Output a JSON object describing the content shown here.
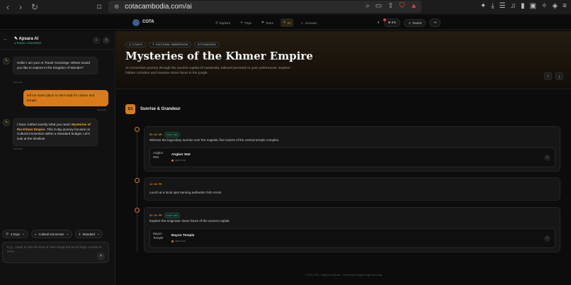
{
  "browser": {
    "url": "cotacambodia.com/ai",
    "brave_badge": "9"
  },
  "app_nav": {
    "brand": "COTA",
    "links": [
      {
        "label": "Explore"
      },
      {
        "label": "Trips"
      },
      {
        "label": "Tours"
      },
      {
        "label": "AI"
      },
      {
        "label": "Account"
      }
    ],
    "language": "EN",
    "role": "Tourist"
  },
  "sidebar": {
    "title": "Apsara AI",
    "subtitle": "● TRAVEL CONCIERGE",
    "messages": [
      {
        "from": "ai",
        "text": "Hello! I am your AI Travel Concierge. Where would you like to explore in the Kingdom of Wonder?",
        "time": "09:41 AM"
      },
      {
        "from": "user",
        "text": "tell me some place in siem reab for culture and temple",
        "time": "09:42 AM"
      },
      {
        "from": "ai",
        "text_before": "I have crafted exactly what you need: ",
        "highlight": "Mysteries of the Khmer Empire",
        "text_after": ". This 3-day journey focuses on Cultural Immersion within a Standard budget. Let's look at the timeline!",
        "time": "09:42 AM"
      }
    ],
    "filters": [
      {
        "label": "3 Days"
      },
      {
        "label": "Cultural Immersion"
      },
      {
        "label": "Standard"
      }
    ],
    "input_placeholder": "E.g., I want to see the best of Siem Reap but avoid large crowds at noon..."
  },
  "hero": {
    "tags": [
      "3 DAYS",
      "CULTURAL IMMERSION",
      "STANDARD"
    ],
    "title": "Mysteries of the Khmer Empire",
    "description": "An immersive journey through the ancient capital of Cambodia, tailored precisely to your preferences. Explore hidden corridors and massive stone faces in the jungle."
  },
  "day": {
    "badge": "D1",
    "title": "Sunrise & Grandeur",
    "activities": [
      {
        "time": "05:00 AM",
        "badge": "MUST SEE",
        "text": "Witness the legendary sunrise over the majestic five towers of the central temple complex.",
        "place": {
          "image_alt": "Angkor Wat",
          "name": "Angkor Wat",
          "category": "HERITAGE"
        }
      },
      {
        "time": "12:00 PM",
        "badge": "",
        "text": "Lunch at a local spot serving authentic Fish Amok.",
        "place": null
      },
      {
        "time": "02:30 PM",
        "badge": "MUST SEE",
        "text": "Explore the enigmatic stone faces of the ancient capital.",
        "place": {
          "image_alt": "Bayon Temple",
          "name": "Bayon Temple",
          "category": "HERITAGE"
        }
      }
    ]
  },
  "footer": "© 2025 COTA · Kingdom of Wonder · Preserving heritage through technology",
  "colors": {
    "accent": "#d97b1a",
    "highlight": "#f0b429",
    "must_see": "#4cc38a",
    "background": "#0c0c0c"
  }
}
